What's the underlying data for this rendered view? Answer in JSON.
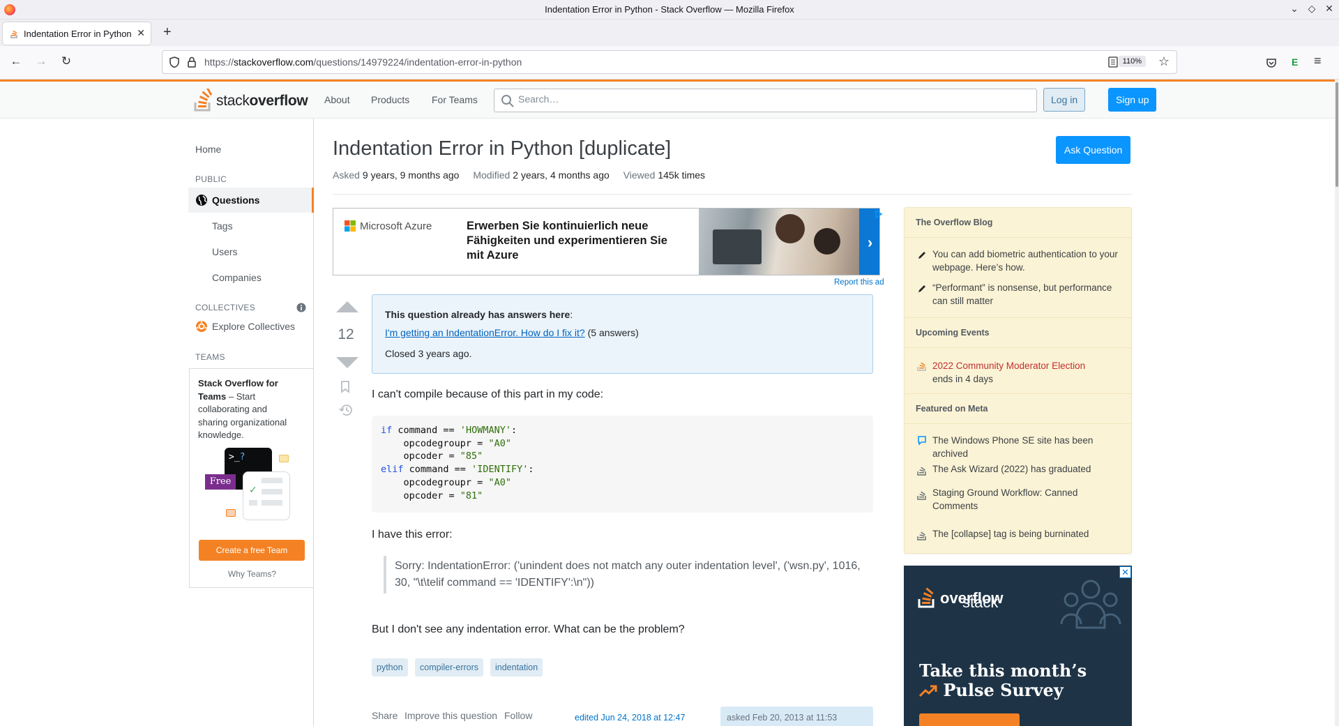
{
  "browser": {
    "window_title": "Indentation Error in Python - Stack Overflow — Mozilla Firefox",
    "tab_title": "Indentation Error in Python",
    "url_prefix": "https://",
    "url_domain": "stackoverflow.com",
    "url_path": "/questions/14979224/indentation-error-in-python",
    "zoom": "110%"
  },
  "topbar": {
    "logo_light": "stack",
    "logo_bold": "overflow",
    "nav": [
      "About",
      "Products",
      "For Teams"
    ],
    "search_placeholder": "Search…",
    "login": "Log in",
    "signup": "Sign up"
  },
  "leftnav": {
    "home": "Home",
    "public_header": "PUBLIC",
    "questions": "Questions",
    "tags": "Tags",
    "users": "Users",
    "companies": "Companies",
    "collectives_header": "COLLECTIVES",
    "explore_collectives": "Explore Collectives",
    "teams_header": "TEAMS",
    "teams_title": "Stack Overflow for Teams",
    "teams_text": " – Start collaborating and sharing organizational knowledge.",
    "free_badge": "Free",
    "create_team": "Create a free Team",
    "why_teams": "Why Teams?"
  },
  "question": {
    "title": "Indentation Error in Python [duplicate]",
    "ask_button": "Ask Question",
    "asked_label": "Asked",
    "asked_value": "9 years, 9 months ago",
    "modified_label": "Modified",
    "modified_value": "2 years, 4 months ago",
    "viewed_label": "Viewed",
    "viewed_value": "145k times",
    "votes": "12",
    "duplicate_header": "This question already has answers here",
    "duplicate_link": "I'm getting an IndentationError. How do I fix it?",
    "duplicate_count": " (5 answers)",
    "closed_text": "Closed 3 years ago.",
    "para1": "I can't compile because of this part in my code:",
    "code": {
      "line1_kw": "if",
      "line1_mid": " command == ",
      "line1_str": "'HOWMANY'",
      "line1_end": ":",
      "line2_pre": "    opcodegroupr = ",
      "line2_str": "\"A0\"",
      "line3_pre": "    opcoder = ",
      "line3_str": "\"85\"",
      "line4_kw": "elif",
      "line4_mid": " command == ",
      "line4_str": "'IDENTIFY'",
      "line4_end": ":",
      "line5_pre": "    opcodegroupr = ",
      "line5_str": "\"A0\"",
      "line6_pre": "    opcoder = ",
      "line6_str": "\"81\""
    },
    "para2": "I have this error:",
    "error_quote": "Sorry: IndentationError: ('unindent does not match any outer indentation level', ('wsn.py', 1016, 30, \"\\t\\telif command == 'IDENTIFY':\\n\"))",
    "para3": "But I don't see any indentation error. What can be the problem?",
    "tags": [
      "python",
      "compiler-errors",
      "indentation"
    ],
    "share": "Share",
    "improve": "Improve this question",
    "follow": "Follow",
    "edited": "edited Jun 24, 2018 at 12:47",
    "asked_card": "asked Feb 20, 2013 at 11:53"
  },
  "ad": {
    "brand": "Microsoft Azure",
    "text": "Erwerben Sie kontinuierlich neue Fähigkeiten und experimentieren Sie mit Azure",
    "arrow": "›",
    "report": "Report this ad"
  },
  "sidebar": {
    "blog_header": "The Overflow Blog",
    "blog_items": [
      "You can add biometric authentication to your webpage. Here’s how.",
      "“Performant” is nonsense, but performance can still matter"
    ],
    "events_header": "Upcoming Events",
    "event_title": "2022 Community Moderator Election",
    "event_sub": "ends in 4 days",
    "meta_header": "Featured on Meta",
    "meta_items": [
      "The Windows Phone SE site has been archived",
      "The Ask Wizard (2022) has graduated",
      "Staging Ground Workflow: Canned Comments",
      "The [collapse] tag is being burninated"
    ]
  },
  "side_ad": {
    "logo_light": "stack",
    "logo_bold": "overflow",
    "headline_1": "Take this month’s",
    "headline_2": "Pulse Survey",
    "close": "✕"
  }
}
